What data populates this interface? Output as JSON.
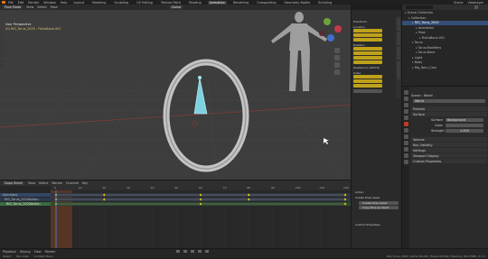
{
  "colors": {
    "accent": "#e87d0d",
    "selected": "#334f77",
    "keyframe": "#e6c229",
    "field_highlight": "#bfa21a"
  },
  "menu": {
    "file": "File",
    "edit": "Edit",
    "render": "Render",
    "window": "Window",
    "help": "Help",
    "workspaces": [
      "Layout",
      "Modeling",
      "Sculpting",
      "UV Editing",
      "Texture Paint",
      "Shading",
      "Animation",
      "Rendering",
      "Compositing",
      "Geometry Nodes",
      "Scripting"
    ],
    "active_workspace": "Animation",
    "scene": "Scene",
    "view_layer": "ViewLayer"
  },
  "viewport": {
    "mode": "Pose Mode",
    "view": "View",
    "select": "Select",
    "pose": "Pose",
    "orientation": "Global",
    "overlay_title": "User Perspective",
    "overlay_object": "(0) RIG_Torus_2020 : FistraBone.001"
  },
  "npanel": {
    "transform_label": "Transform",
    "location": "Location",
    "rotation": "Rotation",
    "mode": "Quaternion (WXYZ)",
    "scale": "Scale",
    "tabs": [
      "Item",
      "Tool",
      "View",
      "Animation"
    ]
  },
  "dopesheet": {
    "editor": "Dope Sheet",
    "view": "View",
    "select": "Select",
    "marker": "Marker",
    "channel": "Channel",
    "key": "Key",
    "channels": [
      "Summary",
      "RIG_Torus_2020Action",
      "RIG_Torus_2020Action"
    ],
    "ruler": [
      "0",
      "10",
      "20",
      "30",
      "40",
      "50",
      "60",
      "70",
      "80",
      "90",
      "100",
      "110",
      "120"
    ],
    "key_frames": [
      [
        0,
        20,
        60,
        80,
        120
      ],
      [
        0,
        20,
        60,
        80,
        120
      ],
      [
        0,
        60,
        120
      ]
    ],
    "current_frame": 0,
    "frame_end": 120
  },
  "ds_side": {
    "action": "Action",
    "create_pose": "Create Pose Asset",
    "asset_name": "Create Pose Asset",
    "copy_asset": "Copy Pose as Asset",
    "custom_props": "Custom Properties"
  },
  "playback": {
    "playback": "Playback",
    "keying": "Keying",
    "view": "View",
    "marker": "Marker"
  },
  "status": {
    "select": "Select",
    "pan": "Pan View",
    "menu": "Context Menu",
    "info": "RIG_Torus_2020 | Verts:18,432 | Faces:18,432 | Memory: 80.6 MiB | 3.3.1"
  },
  "outliner": {
    "rows": [
      {
        "label": "Scene Collection",
        "indent": 0,
        "selected": false
      },
      {
        "label": "Collection",
        "indent": 1,
        "selected": false
      },
      {
        "label": "RIG_Torus_2020",
        "indent": 2,
        "selected": true
      },
      {
        "label": "Animation",
        "indent": 3,
        "selected": false
      },
      {
        "label": "Pose",
        "indent": 3,
        "selected": false
      },
      {
        "label": "FistraBone.001",
        "indent": 4,
        "selected": false
      },
      {
        "label": "Torus",
        "indent": 2,
        "selected": false
      },
      {
        "label": "Torus.Modifiers",
        "indent": 3,
        "selected": false
      },
      {
        "label": "Torus.Bone",
        "indent": 3,
        "selected": false
      },
      {
        "label": "Light",
        "indent": 2,
        "selected": false
      },
      {
        "label": "Body",
        "indent": 2,
        "selected": false
      },
      {
        "label": "Rig_Item_Cam",
        "indent": 2,
        "selected": false
      }
    ]
  },
  "properties": {
    "scene": "Scene",
    "world": "World",
    "world_name": "World",
    "preview": "Preview",
    "surface_panel": "Surface",
    "surface": "Surface",
    "surface_val": "Background",
    "color": "Color",
    "strength": "Strength",
    "strength_val": "1.000",
    "volume": "Volume",
    "ray_visibility": "Ray Visibility",
    "settings": "Settings",
    "viewport_display": "Viewport Display",
    "custom_props": "Custom Properties"
  }
}
